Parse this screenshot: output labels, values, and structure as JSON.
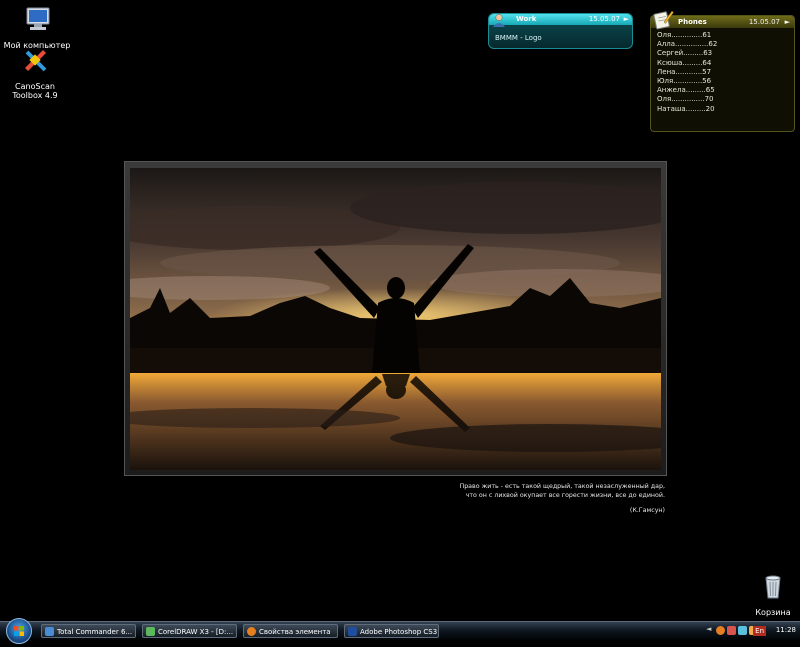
{
  "desktop": {
    "icons": [
      {
        "label": "Мой компьютер"
      },
      {
        "label": "CanoScan Toolbox 4.9"
      },
      {
        "label": "Корзина"
      }
    ]
  },
  "work_gadget": {
    "title": "Work",
    "date": "15.05.07",
    "text": "BMMM - Logo"
  },
  "phones_gadget": {
    "title": "Phones",
    "date": "15.05.07",
    "entries": [
      "Оля..............61",
      "Алла...............62",
      "Сергей.........63",
      "Ксюша.........64",
      "Лена............57",
      "Юля.............56",
      "Анжела.........65",
      "Оля...............70",
      "Наташа.........20"
    ]
  },
  "quote": {
    "line1": "Право жить - есть такой щедрый, такой незаслуженный дар,",
    "line2": "что он с лихвой окупает все горести жизни, все до единой.",
    "author": "(К.Гамсун)"
  },
  "taskbar": {
    "buttons": [
      {
        "label": "Total Commander 6...",
        "icon": "total-commander-icon",
        "color": "#4a8bd6"
      },
      {
        "label": "CorelDRAW X3 - [D:...",
        "icon": "coreldraw-icon",
        "color": "#5cb85c"
      },
      {
        "label": "Свойства элемента",
        "icon": "firefox-icon",
        "color": "#e67e22"
      },
      {
        "label": "Adobe Photoshop CS3",
        "icon": "photoshop-icon",
        "color": "#1f4e9c"
      }
    ],
    "language": "En",
    "clock": "11:28"
  }
}
